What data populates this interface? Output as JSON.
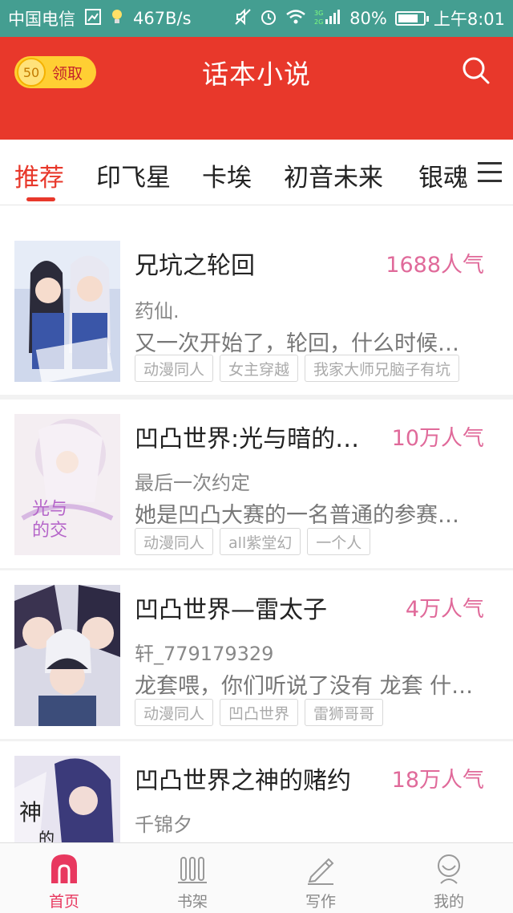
{
  "status_bar": {
    "carrier": "中国电信",
    "speed": "467B/s",
    "battery": "80%",
    "battery_level": 0.8,
    "time": "上午8:01",
    "network": "3G 2G"
  },
  "header": {
    "title": "话本小说",
    "coin_value": "50",
    "claim_label": "领取",
    "icons": {
      "search": "search-icon",
      "coin": "coin-icon"
    },
    "colors": {
      "header_bg": "#e8382b",
      "status_bg": "#449e91",
      "accent_pink": "#e06a9a"
    }
  },
  "tabs": [
    {
      "label": "推荐",
      "active": true
    },
    {
      "label": "印飞星",
      "active": false
    },
    {
      "label": "卡埃",
      "active": false
    },
    {
      "label": "初音未来",
      "active": false
    },
    {
      "label": "银魂",
      "active": false
    }
  ],
  "books": [
    {
      "title": "兄坑之轮回",
      "popularity": "1688人气",
      "author": "药仙.",
      "description": "又一次开始了，轮回，什么时候…",
      "tags": [
        "动漫同人",
        "女主穿越",
        "我家大师兄脑子有坑"
      ],
      "cover_text": "我家大师兄脑子有坑"
    },
    {
      "title": "凹凸世界:光与暗的…",
      "popularity": "10万人气",
      "author": "最后一次约定",
      "description": "她是凹凸大赛的一名普通的参赛…",
      "tags": [
        "动漫同人",
        "all紫堂幻",
        "一个人"
      ],
      "cover_text": "光与暗的交错"
    },
    {
      "title": "凹凸世界—雷太子",
      "popularity": "4万人气",
      "author": "轩_779179329",
      "description": "龙套喂，你们听说了没有 龙套 什…",
      "tags": [
        "动漫同人",
        "凹凸世界",
        "雷狮哥哥"
      ],
      "cover_text": ""
    },
    {
      "title": "凹凸世界之神的赌约",
      "popularity": "18万人气",
      "author": "千锦夕",
      "description": "",
      "tags": [],
      "cover_text": "神的"
    }
  ],
  "bottom_nav": [
    {
      "label": "首页",
      "icon": "home-icon",
      "active": true
    },
    {
      "label": "书架",
      "icon": "bookshelf-icon",
      "active": false
    },
    {
      "label": "写作",
      "icon": "pencil-icon",
      "active": false
    },
    {
      "label": "我的",
      "icon": "profile-icon",
      "active": false
    }
  ]
}
